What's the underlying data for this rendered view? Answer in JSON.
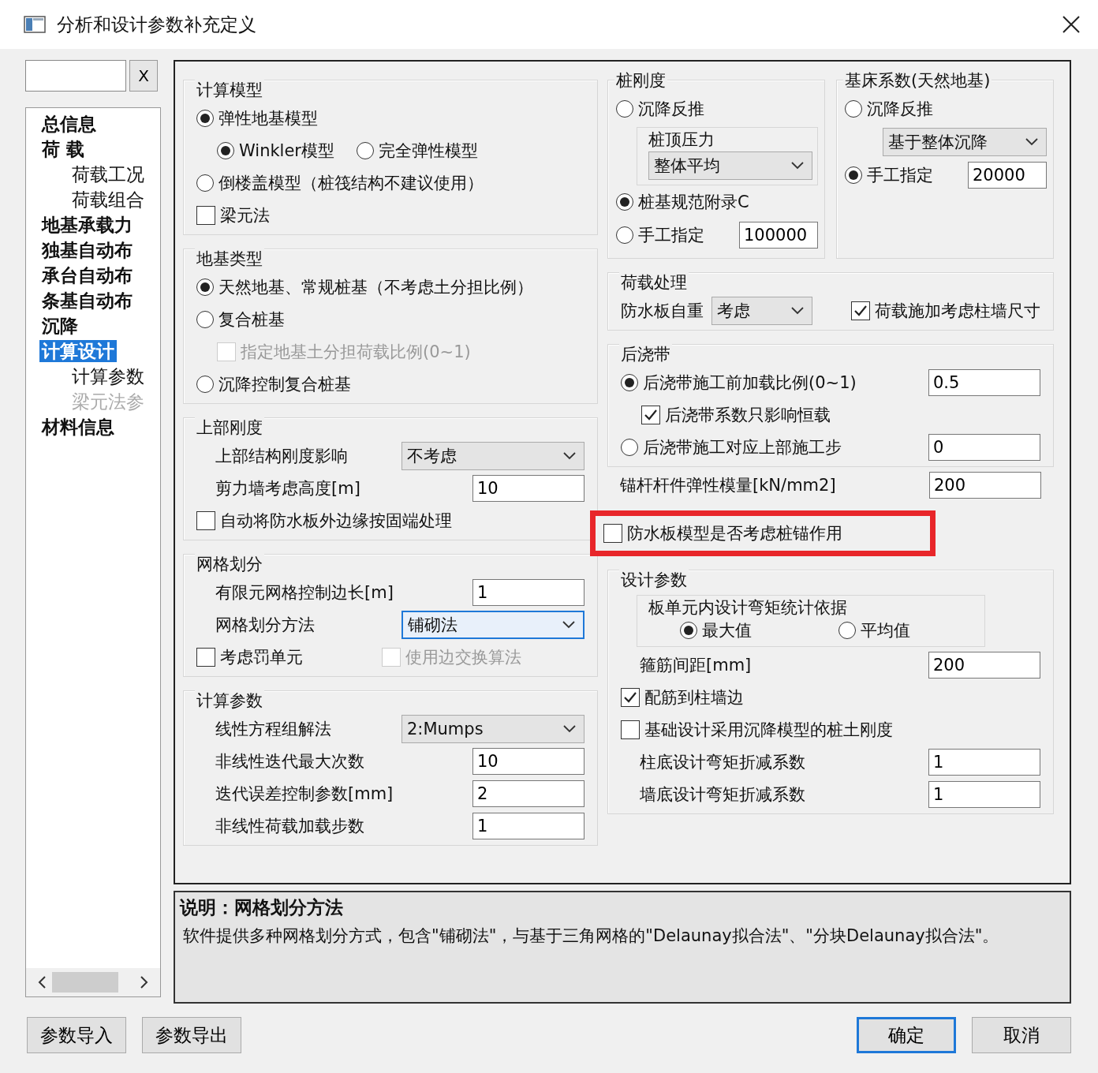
{
  "window": {
    "title": "分析和设计参数补充定义"
  },
  "sidebar": {
    "search": {
      "button": "X"
    },
    "items": [
      {
        "label": "总信息",
        "selected": false,
        "disabled": false
      },
      {
        "label": "荷 载",
        "selected": false,
        "disabled": false,
        "children": [
          {
            "label": "荷载工况",
            "selected": false,
            "disabled": false
          },
          {
            "label": "荷载组合",
            "selected": false,
            "disabled": false
          }
        ]
      },
      {
        "label": "地基承载力",
        "selected": false,
        "disabled": false
      },
      {
        "label": "独基自动布",
        "selected": false,
        "disabled": false
      },
      {
        "label": "承台自动布",
        "selected": false,
        "disabled": false
      },
      {
        "label": "条基自动布",
        "selected": false,
        "disabled": false
      },
      {
        "label": "沉降",
        "selected": false,
        "disabled": false
      },
      {
        "label": "计算设计",
        "selected": true,
        "disabled": false,
        "children": [
          {
            "label": "计算参数",
            "selected": false,
            "disabled": false
          },
          {
            "label": "梁元法参",
            "selected": false,
            "disabled": true
          }
        ]
      },
      {
        "label": "材料信息",
        "selected": false,
        "disabled": false
      }
    ]
  },
  "left_groups": [
    {
      "title": "计算模型",
      "rows": [
        {
          "kind": "radio",
          "label": "弹性地基模型",
          "selected": true,
          "children": [
            {
              "kind": "radio_row",
              "options": [
                {
                  "label": "Winkler模型",
                  "selected": true
                },
                {
                  "label": "完全弹性模型",
                  "selected": false
                }
              ]
            }
          ]
        },
        {
          "kind": "radio",
          "label": "倒楼盖模型（桩筏结构不建议使用）",
          "selected": false
        },
        {
          "kind": "checkbox",
          "label": "梁元法",
          "checked": false,
          "disabled": false
        }
      ]
    },
    {
      "title": "地基类型",
      "rows": [
        {
          "kind": "radio",
          "label": "天然地基、常规桩基（不考虑土分担比例）",
          "selected": true
        },
        {
          "kind": "radio",
          "label": "复合桩基",
          "selected": false,
          "children": [
            {
              "kind": "checkbox",
              "label": "指定地基土分担荷载比例(0~1)",
              "checked": false,
              "disabled": true
            }
          ]
        },
        {
          "kind": "radio",
          "label": "沉降控制复合桩基",
          "selected": false
        }
      ]
    },
    {
      "title": "上部刚度",
      "rows": [
        {
          "kind": "select",
          "label": "上部结构刚度影响",
          "value": "不考虑",
          "focused": false
        },
        {
          "kind": "input",
          "label": "剪力墙考虑高度[m]",
          "value": "10"
        },
        {
          "kind": "checkbox",
          "label": "自动将防水板外边缘按固端处理",
          "checked": false,
          "disabled": false
        }
      ]
    },
    {
      "title": "网格划分",
      "rows": [
        {
          "kind": "input",
          "label": "有限元网格控制边长[m]",
          "value": "1"
        },
        {
          "kind": "select",
          "label": "网格划分方法",
          "value": "铺砌法",
          "focused": true
        },
        {
          "kind": "checkbox_row",
          "items": [
            {
              "label": "考虑罚单元",
              "checked": false,
              "disabled": false
            },
            {
              "label": "使用边交换算法",
              "checked": false,
              "disabled": true
            }
          ]
        }
      ]
    },
    {
      "title": "计算参数",
      "rows": [
        {
          "kind": "select",
          "label": "线性方程组解法",
          "value": "2:Mumps",
          "focused": false
        },
        {
          "kind": "input",
          "label": "非线性迭代最大次数",
          "value": "10"
        },
        {
          "kind": "input",
          "label": "迭代误差控制参数[mm]",
          "value": "2"
        },
        {
          "kind": "input",
          "label": "非线性荷载加载步数",
          "value": "1"
        }
      ]
    }
  ],
  "right_top_groups": [
    {
      "title": "桩刚度",
      "rows": [
        {
          "kind": "radio",
          "label": "沉降反推",
          "selected": false,
          "children": [
            {
              "kind": "subgroup",
              "title": "桩顶压力",
              "rows": [
                {
                  "kind": "select_only",
                  "value": "整体平均",
                  "focused": false
                }
              ]
            }
          ]
        },
        {
          "kind": "radio",
          "label": "桩基规范附录C",
          "selected": true
        },
        {
          "kind": "radio_input",
          "label": "手工指定",
          "selected": false,
          "value": "100000"
        }
      ]
    },
    {
      "title": "基床系数(天然地基)",
      "rows": [
        {
          "kind": "radio",
          "label": "沉降反推",
          "selected": false,
          "children": [
            {
              "kind": "select_only",
              "value": "基于整体沉降",
              "focused": false
            }
          ]
        },
        {
          "kind": "radio_input",
          "label": "手工指定",
          "selected": true,
          "value": "20000"
        }
      ]
    }
  ],
  "right_groups": [
    {
      "title": "荷载处理",
      "rows": [
        {
          "kind": "select_check",
          "label": "防水板自重",
          "value": "考虑",
          "focused": false,
          "check": {
            "label": "荷载施加考虑柱墙尺寸",
            "checked": true,
            "disabled": false
          }
        }
      ]
    },
    {
      "title": "后浇带",
      "rows": [
        {
          "kind": "radio_input",
          "label": "后浇带施工前加载比例(0~1)",
          "selected": true,
          "value": "0.5",
          "children": [
            {
              "kind": "checkbox",
              "label": "后浇带系数只影响恒载",
              "checked": true,
              "disabled": false
            }
          ]
        },
        {
          "kind": "radio_input",
          "label": "后浇带施工对应上部施工步",
          "selected": false,
          "value": "0"
        }
      ]
    },
    {
      "rows": [
        {
          "kind": "input",
          "label": "锚杆杆件弹性模量[kN/mm2]",
          "value": "200"
        }
      ]
    }
  ],
  "callout": {
    "label": "防水板模型是否考虑桩锚作用",
    "checked": false
  },
  "lower_right_groups": [
    {
      "title": "设计参数",
      "rows": [
        {
          "kind": "subgroup",
          "title": "板单元内设计弯矩统计依据",
          "rows": [
            {
              "kind": "radio_row",
              "options": [
                {
                  "label": "最大值",
                  "selected": true
                },
                {
                  "label": "平均值",
                  "selected": false
                }
              ]
            }
          ]
        },
        {
          "kind": "input",
          "label": "箍筋间距[mm]",
          "value": "200"
        },
        {
          "kind": "checkbox",
          "label": "配筋到柱墙边",
          "checked": true,
          "disabled": false
        },
        {
          "kind": "checkbox",
          "label": "基础设计采用沉降模型的桩土刚度",
          "checked": false,
          "disabled": false
        },
        {
          "kind": "input",
          "label": "柱底设计弯矩折减系数",
          "value": "1"
        },
        {
          "kind": "input",
          "label": "墙底设计弯矩折减系数",
          "value": "1"
        }
      ]
    }
  ],
  "description": {
    "title": "说明：网格划分方法",
    "text": "软件提供多种网格划分方式，包含\"铺砌法\"，与基于三角网格的\"Delaunay拟合法\"、\"分块Delaunay拟合法\"。"
  },
  "buttons": [
    {
      "label": "参数导入",
      "default": false
    },
    {
      "label": "参数导出",
      "default": false
    },
    {
      "label": "确定",
      "default": true
    },
    {
      "label": "取消",
      "default": false
    }
  ]
}
